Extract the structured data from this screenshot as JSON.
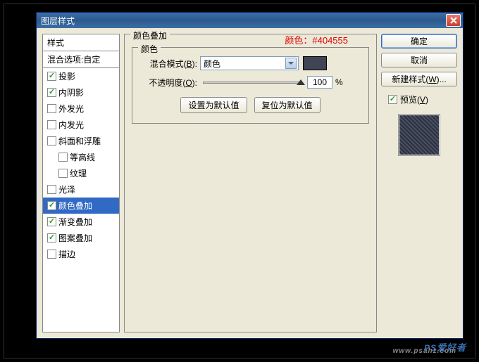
{
  "dialog": {
    "title": "图层样式",
    "annotation": "颜色：#404555"
  },
  "styles": {
    "header": "样式",
    "subheader": "混合选项:自定",
    "items": [
      {
        "label": "投影",
        "checked": true,
        "selected": false,
        "indented": false
      },
      {
        "label": "内阴影",
        "checked": true,
        "selected": false,
        "indented": false
      },
      {
        "label": "外发光",
        "checked": false,
        "selected": false,
        "indented": false
      },
      {
        "label": "内发光",
        "checked": false,
        "selected": false,
        "indented": false
      },
      {
        "label": "斜面和浮雕",
        "checked": false,
        "selected": false,
        "indented": false
      },
      {
        "label": "等高线",
        "checked": false,
        "selected": false,
        "indented": true
      },
      {
        "label": "纹理",
        "checked": false,
        "selected": false,
        "indented": true
      },
      {
        "label": "光泽",
        "checked": false,
        "selected": false,
        "indented": false
      },
      {
        "label": "颜色叠加",
        "checked": true,
        "selected": true,
        "indented": false
      },
      {
        "label": "渐变叠加",
        "checked": true,
        "selected": false,
        "indented": false
      },
      {
        "label": "图案叠加",
        "checked": true,
        "selected": false,
        "indented": false
      },
      {
        "label": "描边",
        "checked": false,
        "selected": false,
        "indented": false
      }
    ]
  },
  "mainPanel": {
    "title": "颜色叠加",
    "fieldset": "颜色",
    "blendMode": {
      "label": "混合模式(",
      "accel": "B",
      "label2": "):",
      "value": "颜色",
      "swatch": "#404555"
    },
    "opacity": {
      "label": "不透明度(",
      "accel": "O",
      "label2": "):",
      "value": "100",
      "unit": "%"
    },
    "buttons": {
      "default": "设置为默认值",
      "reset": "复位为默认值"
    }
  },
  "rightPanel": {
    "ok": "确定",
    "cancel": "取消",
    "newStyle": "新建样式(",
    "newStyleAccel": "W",
    "newStyle2": ")...",
    "preview": "预览(",
    "previewAccel": "V",
    "preview2": ")"
  },
  "watermark": {
    "main": "PS",
    "sub": "爱好者",
    "url": "www.psahz.com"
  }
}
